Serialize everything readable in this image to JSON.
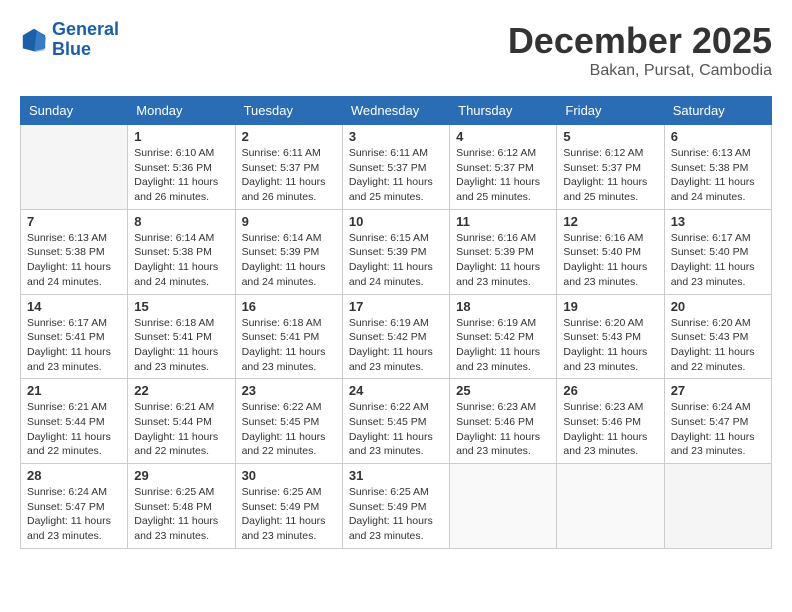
{
  "header": {
    "logo_line1": "General",
    "logo_line2": "Blue",
    "month": "December 2025",
    "location": "Bakan, Pursat, Cambodia"
  },
  "weekdays": [
    "Sunday",
    "Monday",
    "Tuesday",
    "Wednesday",
    "Thursday",
    "Friday",
    "Saturday"
  ],
  "weeks": [
    [
      {
        "day": "",
        "empty": true
      },
      {
        "day": "1",
        "sunrise": "6:10 AM",
        "sunset": "5:36 PM",
        "daylight": "11 hours and 26 minutes."
      },
      {
        "day": "2",
        "sunrise": "6:11 AM",
        "sunset": "5:37 PM",
        "daylight": "11 hours and 26 minutes."
      },
      {
        "day": "3",
        "sunrise": "6:11 AM",
        "sunset": "5:37 PM",
        "daylight": "11 hours and 25 minutes."
      },
      {
        "day": "4",
        "sunrise": "6:12 AM",
        "sunset": "5:37 PM",
        "daylight": "11 hours and 25 minutes."
      },
      {
        "day": "5",
        "sunrise": "6:12 AM",
        "sunset": "5:37 PM",
        "daylight": "11 hours and 25 minutes."
      },
      {
        "day": "6",
        "sunrise": "6:13 AM",
        "sunset": "5:38 PM",
        "daylight": "11 hours and 24 minutes."
      }
    ],
    [
      {
        "day": "7",
        "sunrise": "6:13 AM",
        "sunset": "5:38 PM",
        "daylight": "11 hours and 24 minutes."
      },
      {
        "day": "8",
        "sunrise": "6:14 AM",
        "sunset": "5:38 PM",
        "daylight": "11 hours and 24 minutes."
      },
      {
        "day": "9",
        "sunrise": "6:14 AM",
        "sunset": "5:39 PM",
        "daylight": "11 hours and 24 minutes."
      },
      {
        "day": "10",
        "sunrise": "6:15 AM",
        "sunset": "5:39 PM",
        "daylight": "11 hours and 24 minutes."
      },
      {
        "day": "11",
        "sunrise": "6:16 AM",
        "sunset": "5:39 PM",
        "daylight": "11 hours and 23 minutes."
      },
      {
        "day": "12",
        "sunrise": "6:16 AM",
        "sunset": "5:40 PM",
        "daylight": "11 hours and 23 minutes."
      },
      {
        "day": "13",
        "sunrise": "6:17 AM",
        "sunset": "5:40 PM",
        "daylight": "11 hours and 23 minutes."
      }
    ],
    [
      {
        "day": "14",
        "sunrise": "6:17 AM",
        "sunset": "5:41 PM",
        "daylight": "11 hours and 23 minutes."
      },
      {
        "day": "15",
        "sunrise": "6:18 AM",
        "sunset": "5:41 PM",
        "daylight": "11 hours and 23 minutes."
      },
      {
        "day": "16",
        "sunrise": "6:18 AM",
        "sunset": "5:41 PM",
        "daylight": "11 hours and 23 minutes."
      },
      {
        "day": "17",
        "sunrise": "6:19 AM",
        "sunset": "5:42 PM",
        "daylight": "11 hours and 23 minutes."
      },
      {
        "day": "18",
        "sunrise": "6:19 AM",
        "sunset": "5:42 PM",
        "daylight": "11 hours and 23 minutes."
      },
      {
        "day": "19",
        "sunrise": "6:20 AM",
        "sunset": "5:43 PM",
        "daylight": "11 hours and 23 minutes."
      },
      {
        "day": "20",
        "sunrise": "6:20 AM",
        "sunset": "5:43 PM",
        "daylight": "11 hours and 22 minutes."
      }
    ],
    [
      {
        "day": "21",
        "sunrise": "6:21 AM",
        "sunset": "5:44 PM",
        "daylight": "11 hours and 22 minutes."
      },
      {
        "day": "22",
        "sunrise": "6:21 AM",
        "sunset": "5:44 PM",
        "daylight": "11 hours and 22 minutes."
      },
      {
        "day": "23",
        "sunrise": "6:22 AM",
        "sunset": "5:45 PM",
        "daylight": "11 hours and 22 minutes."
      },
      {
        "day": "24",
        "sunrise": "6:22 AM",
        "sunset": "5:45 PM",
        "daylight": "11 hours and 23 minutes."
      },
      {
        "day": "25",
        "sunrise": "6:23 AM",
        "sunset": "5:46 PM",
        "daylight": "11 hours and 23 minutes."
      },
      {
        "day": "26",
        "sunrise": "6:23 AM",
        "sunset": "5:46 PM",
        "daylight": "11 hours and 23 minutes."
      },
      {
        "day": "27",
        "sunrise": "6:24 AM",
        "sunset": "5:47 PM",
        "daylight": "11 hours and 23 minutes."
      }
    ],
    [
      {
        "day": "28",
        "sunrise": "6:24 AM",
        "sunset": "5:47 PM",
        "daylight": "11 hours and 23 minutes."
      },
      {
        "day": "29",
        "sunrise": "6:25 AM",
        "sunset": "5:48 PM",
        "daylight": "11 hours and 23 minutes."
      },
      {
        "day": "30",
        "sunrise": "6:25 AM",
        "sunset": "5:49 PM",
        "daylight": "11 hours and 23 minutes."
      },
      {
        "day": "31",
        "sunrise": "6:25 AM",
        "sunset": "5:49 PM",
        "daylight": "11 hours and 23 minutes."
      },
      {
        "day": "",
        "empty": true
      },
      {
        "day": "",
        "empty": true
      },
      {
        "day": "",
        "empty": true
      }
    ]
  ]
}
